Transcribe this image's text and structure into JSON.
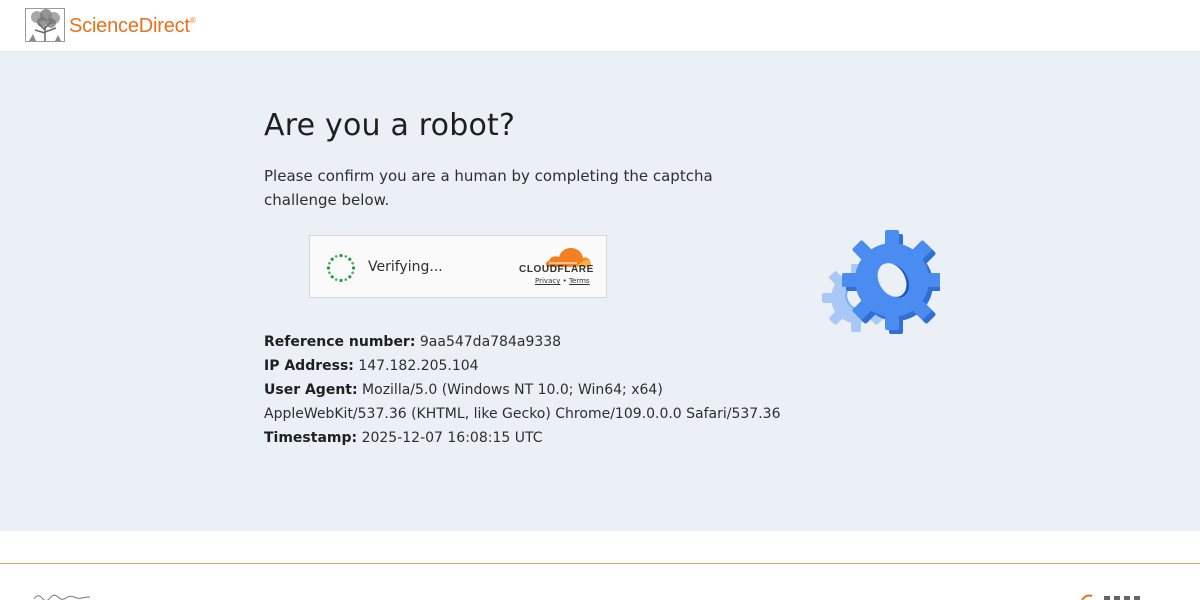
{
  "header": {
    "logo_text": "ScienceDirect",
    "logo_reg": "®"
  },
  "main": {
    "title": "Are you a robot?",
    "intro": "Please confirm you are a human by completing the captcha challenge below.",
    "captcha": {
      "status": "Verifying...",
      "provider": "CLOUDFLARE",
      "privacy_label": "Privacy",
      "separator": "•",
      "terms_label": "Terms"
    },
    "details": {
      "reference_label": "Reference number:",
      "reference_value": "9aa547da784a9338",
      "ip_label": "IP Address:",
      "ip_value": "147.182.205.104",
      "ua_label": "User Agent:",
      "ua_value": "Mozilla/5.0 (Windows NT 10.0; Win64; x64) AppleWebKit/537.36 (KHTML, like Gecko) Chrome/109.0.0.0 Safari/537.36",
      "timestamp_label": "Timestamp:",
      "timestamp_value": "2025-12-07 16:08:15 UTC"
    }
  },
  "colors": {
    "brand_orange": "#e9711c",
    "background": "#ebf0f6",
    "spinner_green": "#1e9e3a",
    "gear_blue": "#4a8cf0",
    "cloudflare_orange": "#f38020",
    "footer_rule": "#e9a23b"
  },
  "icons": {
    "logo": "elsevier-tree-icon",
    "spinner": "loading-spinner-icon",
    "cloudflare": "cloudflare-cloud-icon",
    "gears": "gears-icon"
  }
}
